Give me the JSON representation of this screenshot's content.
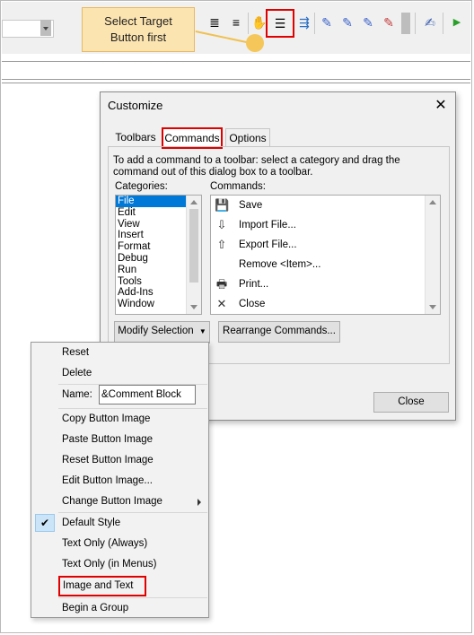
{
  "callout": {
    "text_line1": "Select Target",
    "text_line2": "Button first"
  },
  "toolbar": {
    "icons": [
      "comment-icon",
      "uncomment-icon",
      "hand-icon",
      "comment-block-icon",
      "bookmark-icon",
      "bookmark-toggle-icon",
      "bookmark-next-icon",
      "bookmark-prev-icon",
      "bookmark-clear-icon",
      "edit-icon",
      "run-icon"
    ]
  },
  "dialog": {
    "title": "Customize",
    "close_glyph": "✕",
    "tabs": [
      {
        "label": "Toolbars"
      },
      {
        "label": "Commands"
      },
      {
        "label": "Options"
      }
    ],
    "hint": "To add a command to a toolbar: select a category and drag the command out of this dialog box to a toolbar.",
    "categories_label": "Categories:",
    "commands_label": "Commands:",
    "categories": [
      "File",
      "Edit",
      "View",
      "Insert",
      "Format",
      "Debug",
      "Run",
      "Tools",
      "Add-Ins",
      "Window"
    ],
    "selected_category": "File",
    "commands": [
      {
        "label": "Save",
        "icon": "save-icon"
      },
      {
        "label": "Import File...",
        "icon": "import-icon"
      },
      {
        "label": "Export File...",
        "icon": "export-icon"
      },
      {
        "label": "Remove <Item>...",
        "icon": ""
      },
      {
        "label": "Print...",
        "icon": "print-icon"
      },
      {
        "label": "Close",
        "icon": "close-x-icon"
      }
    ],
    "modify_selection_label": "Modify Selection",
    "rearrange_label": "Rearrange Commands...",
    "close_button_label": "Close"
  },
  "context_menu": {
    "reset": "Reset",
    "delete": "Delete",
    "name_label": "Name:",
    "name_value": "&Comment Block",
    "copy_image": "Copy Button Image",
    "paste_image": "Paste Button Image",
    "reset_image": "Reset Button Image",
    "edit_image": "Edit Button Image...",
    "change_image": "Change Button Image",
    "default_style": "Default Style",
    "text_only_always": "Text Only (Always)",
    "text_only_menus": "Text Only (in Menus)",
    "image_and_text": "Image and Text",
    "begin_group": "Begin a Group"
  },
  "colors": {
    "highlight_red": "#e00000",
    "selection_blue": "#0078d7",
    "callout_fill": "#fce4b0"
  }
}
